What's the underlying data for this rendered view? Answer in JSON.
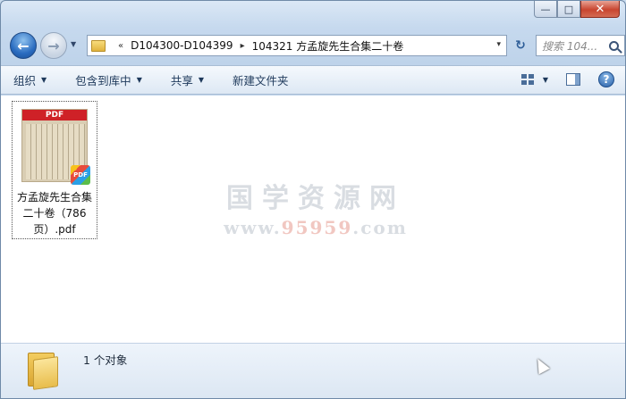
{
  "window": {
    "caption": {
      "minimize": "—",
      "maximize": "□",
      "close": "✕"
    }
  },
  "nav": {
    "back_glyph": "←",
    "forward_glyph": "→",
    "history_glyph": "▼",
    "refresh_glyph": "↻"
  },
  "address": {
    "overflow": "«",
    "crumbs": [
      "D104300-D104399",
      "104321 方孟旋先生合集二十卷"
    ],
    "separator": "▸",
    "dropdown": "▾"
  },
  "search": {
    "placeholder": "搜索 104..."
  },
  "toolbar": {
    "organize": "组织",
    "include_library": "包含到库中",
    "share": "共享",
    "new_folder": "新建文件夹",
    "help": "?"
  },
  "files": [
    {
      "name": "方孟旋先生合集二十卷（786页）.pdf",
      "thumb_band": "PDF",
      "badge": "PDF"
    }
  ],
  "watermark": {
    "title": "国学资源网",
    "url_prefix": "www.",
    "url_accent": "95959",
    "url_suffix": ".com"
  },
  "status": {
    "count_text": "1 个对象"
  },
  "colors": {
    "accent": "#2a6cc0",
    "close": "#c8452f",
    "pdf_red": "#cf2127"
  }
}
